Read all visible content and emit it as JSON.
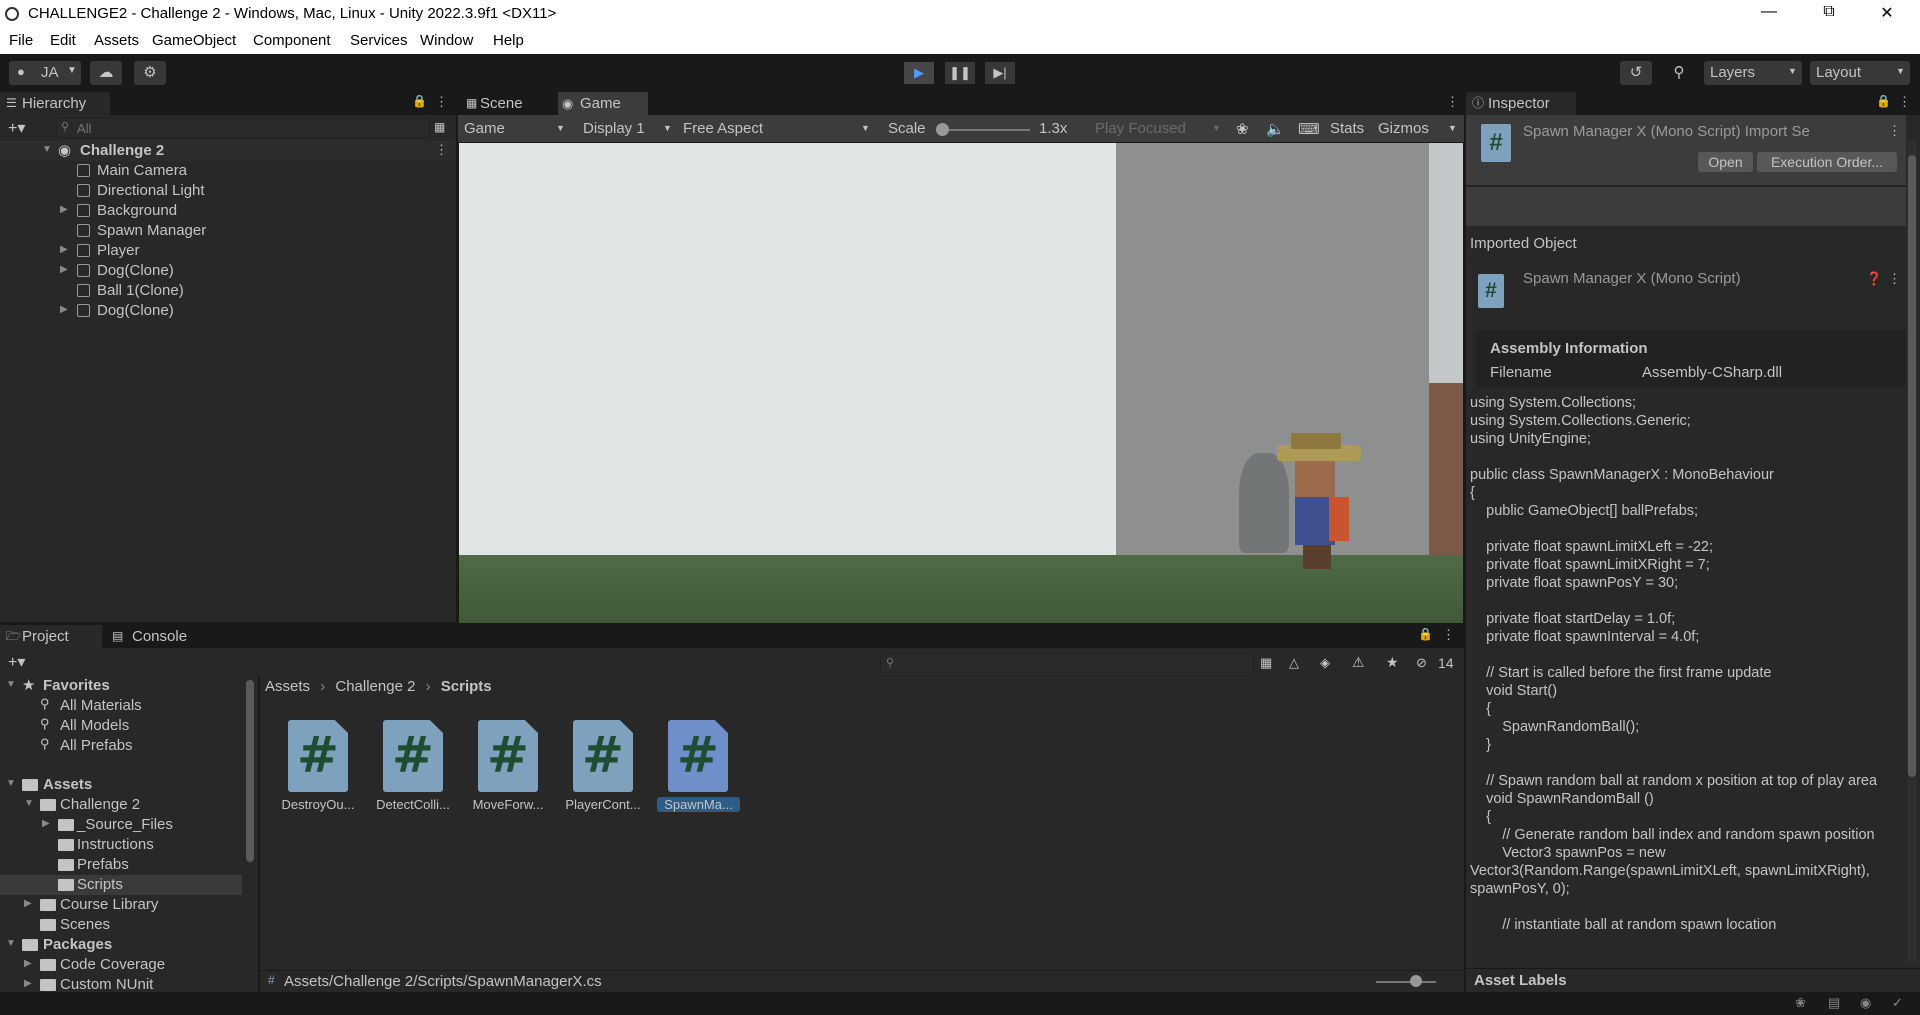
{
  "window": {
    "title": "CHALLENGE2 - Challenge 2 - Windows, Mac, Linux - Unity 2022.3.9f1 <DX11>"
  },
  "menu": [
    "File",
    "Edit",
    "Assets",
    "GameObject",
    "Component",
    "Services",
    "Window",
    "Help"
  ],
  "toolbar": {
    "account": "JA",
    "layers": "Layers",
    "layout": "Layout"
  },
  "hierarchy": {
    "tab": "Hierarchy",
    "search_placeholder": "All",
    "scene": "Challenge 2",
    "items": [
      "Main Camera",
      "Directional Light",
      "Background",
      "Spawn Manager",
      "Player",
      "Dog(Clone)",
      "Ball 1(Clone)",
      "Dog(Clone)"
    ]
  },
  "view_tabs": {
    "scene": "Scene",
    "game": "Game"
  },
  "game_toolbar": {
    "mode": "Game",
    "display": "Display 1",
    "aspect": "Free Aspect",
    "scale_label": "Scale",
    "scale_value": "1.3x",
    "play_focused": "Play Focused",
    "stats": "Stats",
    "gizmos": "Gizmos"
  },
  "inspector": {
    "tab": "Inspector",
    "header_title": "Spawn Manager X (Mono Script) Import Se",
    "open": "Open",
    "exec_order": "Execution Order...",
    "imported_object": "Imported Object",
    "script_title": "Spawn Manager X (Mono Script)",
    "assembly_info": "Assembly Information",
    "filename_label": "Filename",
    "filename_value": "Assembly-CSharp.dll",
    "code": "using System.Collections;\nusing System.Collections.Generic;\nusing UnityEngine;\n\npublic class SpawnManagerX : MonoBehaviour\n{\n    public GameObject[] ballPrefabs;\n\n    private float spawnLimitXLeft = -22;\n    private float spawnLimitXRight = 7;\n    private float spawnPosY = 30;\n\n    private float startDelay = 1.0f;\n    private float spawnInterval = 4.0f;\n\n    // Start is called before the first frame update\n    void Start()\n    {\n        SpawnRandomBall();\n    }\n\n    // Spawn random ball at random x position at top of play area\n    void SpawnRandomBall ()\n    {\n        // Generate random ball index and random spawn position\n        Vector3 spawnPos = new Vector3(Random.Range(spawnLimitXLeft, spawnLimitXRight), spawnPosY, 0);\n\n        // instantiate ball at random spawn location",
    "asset_labels": "Asset Labels"
  },
  "project": {
    "tab": "Project",
    "console_tab": "Console",
    "hidden_count": "14",
    "breadcrumb": [
      "Assets",
      "Challenge 2",
      "Scripts"
    ],
    "tree": {
      "favorites": "Favorites",
      "fav_items": [
        "All Materials",
        "All Models",
        "All Prefabs"
      ],
      "assets": "Assets",
      "challenge": "Challenge 2",
      "challenge_children": [
        "_Source_Files",
        "Instructions",
        "Prefabs",
        "Scripts"
      ],
      "course_library": "Course Library",
      "scenes": "Scenes",
      "packages": "Packages",
      "package_items": [
        "Code Coverage",
        "Custom NUnit"
      ]
    },
    "files": [
      "DestroyOu...",
      "DetectColli...",
      "MoveForw...",
      "PlayerCont...",
      "SpawnMa..."
    ],
    "status_path": "Assets/Challenge 2/Scripts/SpawnManagerX.cs"
  }
}
